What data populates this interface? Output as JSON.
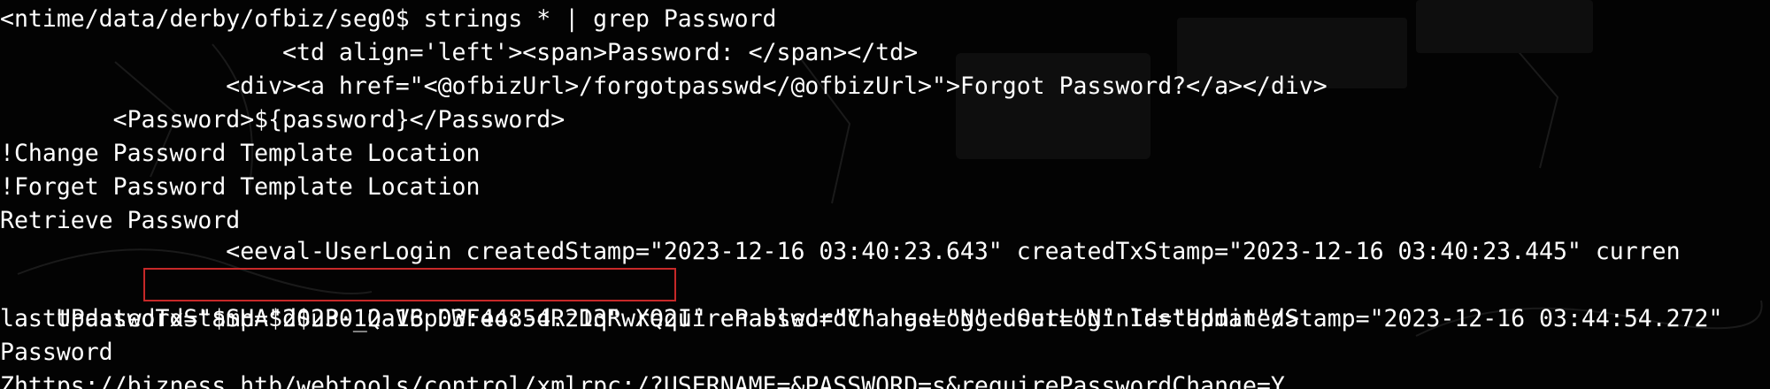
{
  "terminal": {
    "lines": [
      "<ntime/data/derby/ofbiz/seg0$ strings * | grep Password",
      "                    <td align='left'><span>Password: </span></td>",
      "                <div><a href=\"<@ofbizUrl>/forgotpasswd</@ofbizUrl>\">Forgot Password?</a></div>",
      "        <Password>${password}</Password>",
      "!Change Password Template Location",
      "!Forget Password Template Location",
      "Retrieve Password",
      "                <eeval-UserLogin createdStamp=\"2023-12-16 03:40:23.643\" createdTxStamp=\"2023-12-16 03:40:23.445\" curren",
      "",
      "lastUpdatedTxStamp=\"2023-12-16 03:44:54.213\" requirePasswordChange=\"N\" userLoginId=\"admin\"/>",
      "Password",
      "Zhttps://bizness.htb/webtools/control/xmlrpc;/?USERNAME=&PASSWORD=s&requirePasswordChange=Y"
    ],
    "line8": {
      "prefix": "tPassword=",
      "hash": "\"$SHA$d$uP0_QaVBpDWFeo8-dRzDqRwXQ2I\"",
      "suffix": " enabled=\"Y\" hasLoggedOut=\"N\" lastUpdatedStamp=\"2023-12-16 03:44:54.272\""
    },
    "highlight_color": "#c62828",
    "text_color": "#ffffff",
    "background_color": "#030303"
  }
}
